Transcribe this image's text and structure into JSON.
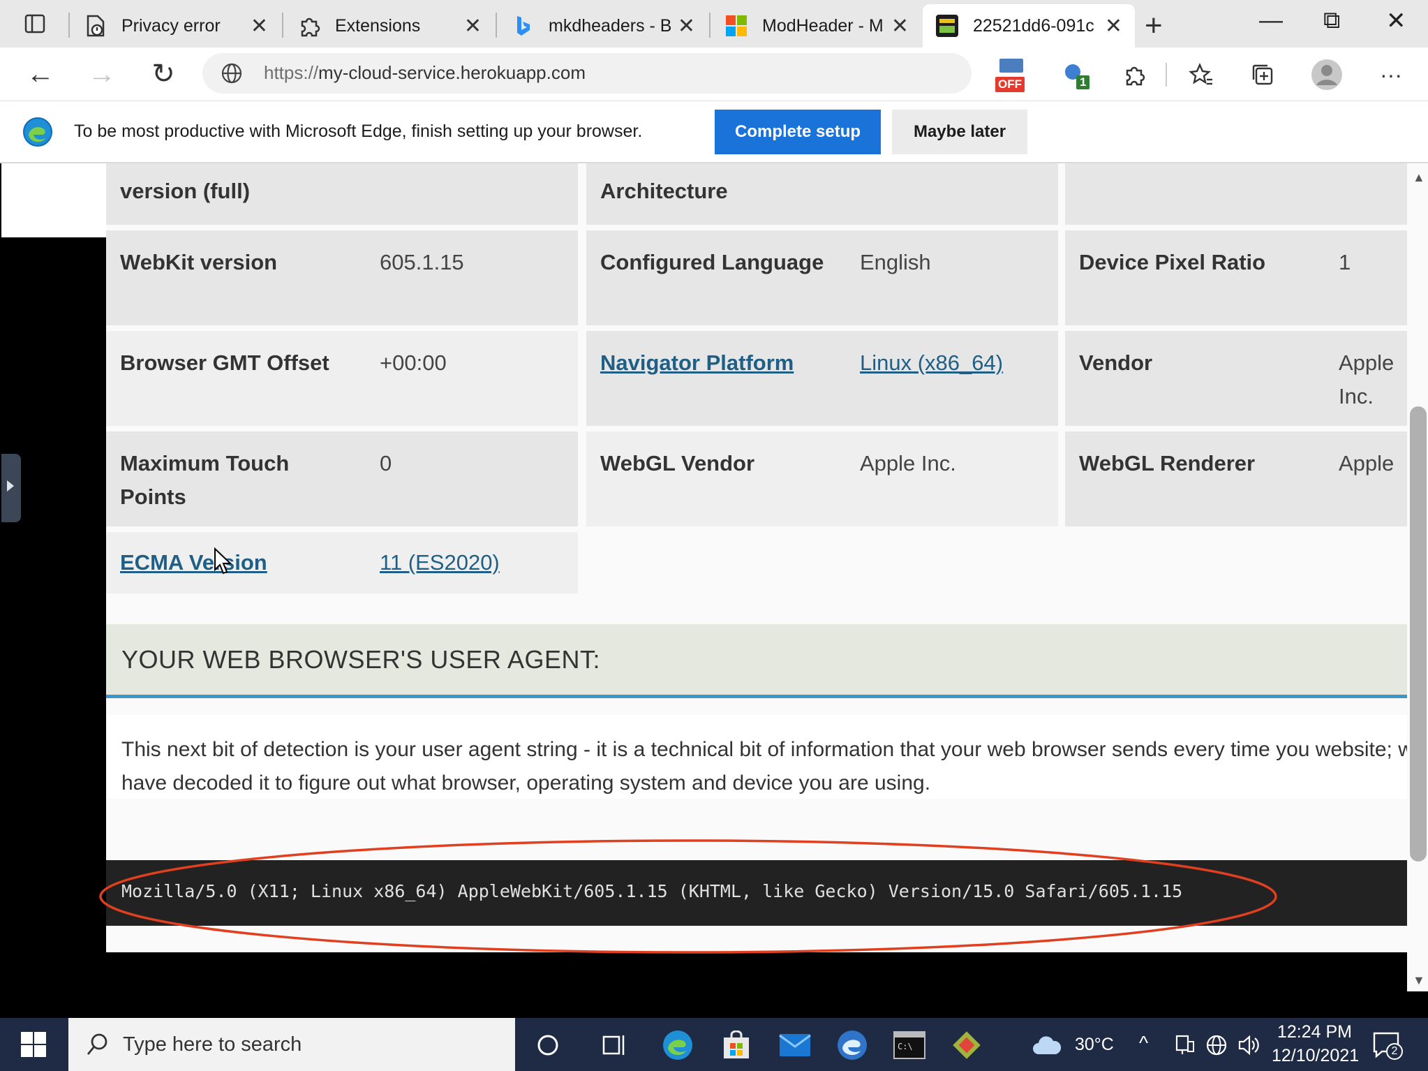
{
  "browser": {
    "tabs": [
      {
        "title": "Privacy error",
        "icon": "privacy-error-icon"
      },
      {
        "title": "Extensions",
        "icon": "extensions-puzzle-icon"
      },
      {
        "title": "mkdheaders - Bi",
        "icon": "bing-icon"
      },
      {
        "title": "ModHeader - M",
        "icon": "microsoft-store-icon"
      },
      {
        "title": "22521dd6-091c",
        "icon": "vnc-icon",
        "active": true
      }
    ],
    "url_scheme": "https://",
    "url_host": "my-cloud-service.herokuapp.com",
    "extension_badge_off": "OFF",
    "extension_badge_count": "1"
  },
  "setup_bar": {
    "message": "To be most productive with Microsoft Edge, finish setting up your browser.",
    "primary_label": "Complete setup",
    "secondary_label": "Maybe later"
  },
  "info_rows": [
    [
      {
        "key": "version (full)",
        "value": ""
      },
      {
        "key": "Architecture",
        "value": ""
      },
      {
        "key": "",
        "value": ""
      }
    ],
    [
      {
        "key": "WebKit version",
        "value": "605.1.15"
      },
      {
        "key": "Configured Language",
        "value": "English"
      },
      {
        "key": "Device Pixel Ratio",
        "value": "1"
      }
    ],
    [
      {
        "key": "Browser GMT Offset",
        "value": "+00:00"
      },
      {
        "key": "Navigator Platform",
        "value": "Linux (x86_64)",
        "link": true
      },
      {
        "key": "Vendor",
        "value": "Apple Inc."
      }
    ],
    [
      {
        "key": "Maximum Touch Points",
        "value": "0"
      },
      {
        "key": "WebGL Vendor",
        "value": "Apple Inc."
      },
      {
        "key": "WebGL Renderer",
        "value": "Apple"
      }
    ],
    [
      {
        "key": "ECMA Version",
        "value": "11 (ES2020)",
        "link": true
      }
    ]
  ],
  "user_agent": {
    "heading": "YOUR WEB BROWSER'S USER AGENT:",
    "description": "This next bit of detection is your user agent string - it is a technical bit of information that your web browser sends every time you website; we have decoded it to figure out what browser, operating system and device you are using.",
    "string": "Mozilla/5.0 (X11; Linux x86_64) AppleWebKit/605.1.15 (KHTML, like Gecko) Version/15.0 Safari/605.1.15",
    "annotation_color": "#e0401f"
  },
  "taskbar": {
    "search_placeholder": "Type here to search",
    "temperature": "30°C",
    "time": "12:24 PM",
    "date": "12/10/2021",
    "notification_count": "2"
  },
  "colors": {
    "edge_blue": "#1a73d9",
    "link": "#1f5f86",
    "heading_underline": "#3d95c9",
    "taskbar": "#1f2b45"
  }
}
